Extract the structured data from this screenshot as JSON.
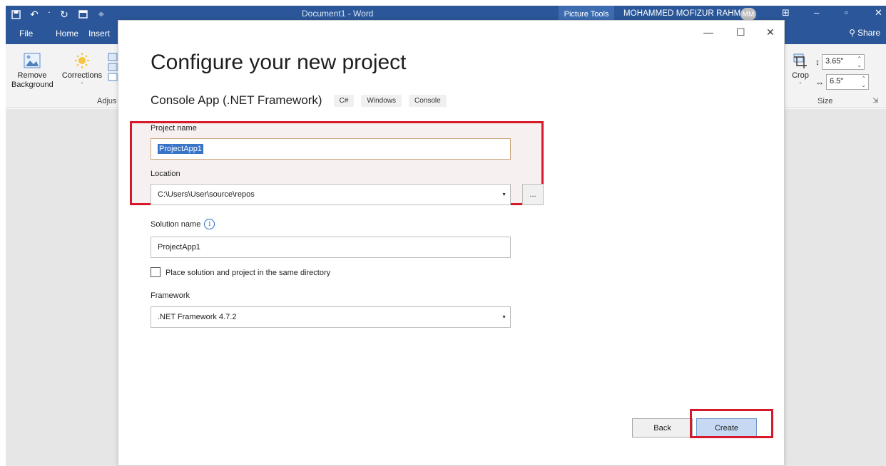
{
  "word": {
    "title": "Document1  -  Word",
    "picture_tools": "Picture Tools",
    "user": "MOHAMMED MOFIZUR RAHMAN",
    "avatar_initials": "MM",
    "tabs": [
      "File",
      "Home",
      "Insert"
    ],
    "share": "Share",
    "ribbon": {
      "remove_background": "Remove Background",
      "corrections": "Corrections",
      "adjust_group": "Adjus",
      "crop": "Crop",
      "height_value": "3.65\"",
      "width_value": "6.5\"",
      "size_group": "Size"
    }
  },
  "dialog": {
    "title": "Configure your new project",
    "template_name": "Console App (.NET Framework)",
    "tags": [
      "C#",
      "Windows",
      "Console"
    ],
    "project_name_label": "Project name",
    "project_name_value": "ProjectApp1",
    "location_label": "Location",
    "location_value": "C:\\Users\\User\\source\\repos",
    "browse_label": "...",
    "solution_name_label": "Solution name",
    "solution_name_value": "ProjectApp1",
    "same_directory_label": "Place solution and project in the same directory",
    "same_directory_checked": false,
    "framework_label": "Framework",
    "framework_value": ".NET Framework 4.7.2",
    "back_button": "Back",
    "create_button": "Create"
  },
  "colors": {
    "word_blue": "#2b579a",
    "highlight_red": "#d6192b",
    "primary_button": "#c6d8f2"
  }
}
